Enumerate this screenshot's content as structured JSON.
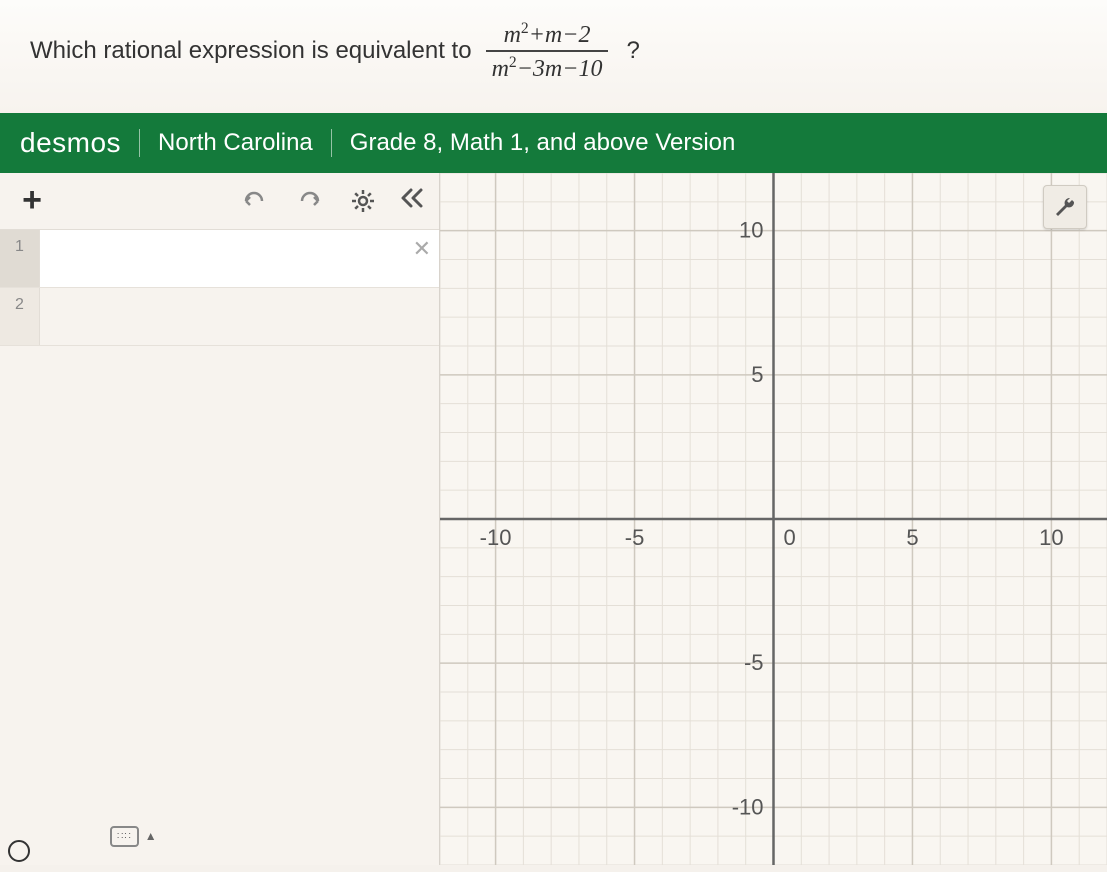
{
  "question": {
    "prefix": "Which rational expression is equivalent to",
    "frac_num": "m² + m − 2",
    "frac_den": "m² − 3m − 10",
    "suffix": "?"
  },
  "header": {
    "logo": "desmos",
    "region": "North Carolina",
    "version": "Grade 8, Math 1, and above Version"
  },
  "toolbar": {
    "add": "+",
    "undo_icon": "undo-icon",
    "redo_icon": "redo-icon",
    "settings_icon": "gear-icon",
    "collapse": "《"
  },
  "expressions": [
    {
      "index": "1",
      "active": true,
      "delete_label": "✕"
    },
    {
      "index": "2",
      "active": false
    }
  ],
  "keyboard": {
    "label": "⌨",
    "state": "▲"
  },
  "graph": {
    "x_ticks": [
      {
        "v": -10,
        "label": "-10"
      },
      {
        "v": -5,
        "label": "-5"
      },
      {
        "v": 0,
        "label": "0"
      },
      {
        "v": 5,
        "label": "5"
      },
      {
        "v": 10,
        "label": "10"
      }
    ],
    "y_ticks": [
      {
        "v": 10,
        "label": "10"
      },
      {
        "v": 5,
        "label": "5"
      },
      {
        "v": -5,
        "label": "-5"
      },
      {
        "v": -10,
        "label": "-10"
      }
    ],
    "x_range": [
      -12,
      12
    ],
    "y_range": [
      -12,
      12
    ],
    "wrench_icon": "wrench-icon"
  },
  "chart_data": {
    "type": "scatter",
    "series": [],
    "xlabel": "",
    "ylabel": "",
    "xlim": [
      -12,
      12
    ],
    "ylim": [
      -12,
      12
    ],
    "grid": true
  }
}
